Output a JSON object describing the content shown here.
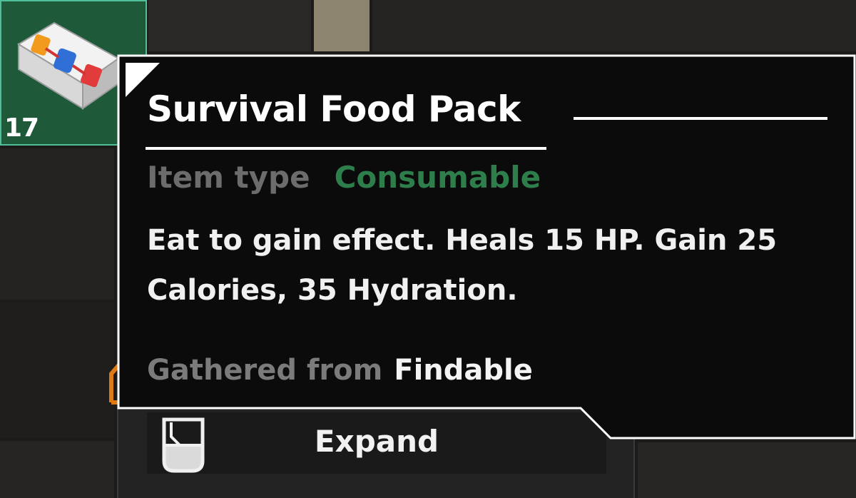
{
  "slot": {
    "count": "17",
    "icon": "food-pack-icon"
  },
  "tooltip": {
    "title": "Survival Food Pack",
    "item_type_label": "Item type",
    "item_type_value": "Consumable",
    "description": "Eat to gain effect. Heals 15 HP. Gain 25 Calories, 35 Hydration.",
    "gathered_label": "Gathered from",
    "gathered_value": "Findable"
  },
  "action": {
    "label": "Expand",
    "icon": "expand-key-icon"
  },
  "colors": {
    "consumable": "#2e7e4c",
    "slot_bg": "#1e5a3a",
    "slot_border": "#4fbf9a",
    "accent_orange": "#e07a12"
  }
}
